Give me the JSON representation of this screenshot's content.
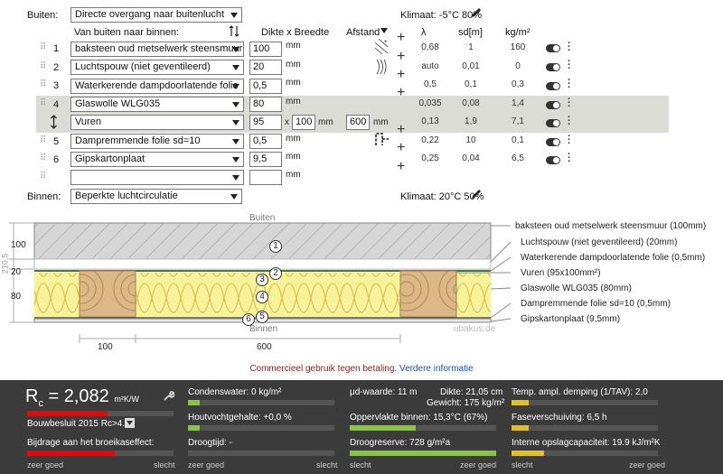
{
  "header": {
    "outside_label": "Buiten:",
    "outside_value": "Directe overgang naar buitenlucht",
    "climate_out": "Klimaat: -5°C 80%",
    "inside_label": "Binnen:",
    "inside_value": "Beperkte luchtcirculatie",
    "climate_in": "Klimaat: 20°C 50%"
  },
  "columns": {
    "layers": "Van buiten naar binnen:",
    "thickness": "Dikte x Breedte",
    "spacing": "Afstand",
    "lambda": "λ",
    "sd": "sd[m]",
    "density": "kg/m²"
  },
  "layers": [
    {
      "num": "1",
      "name": "baksteen oud metselwerk steensmuur",
      "thick": "100",
      "unit": "mm",
      "lambda": "0,68",
      "sd": "1",
      "kg": "160"
    },
    {
      "num": "2",
      "name": "Luchtspouw (niet geventileerd)",
      "thick": "20",
      "unit": "mm",
      "lambda": "auto",
      "sd": "0,01",
      "kg": "0"
    },
    {
      "num": "3",
      "name": "Waterkerende dampdoorlatende folie",
      "thick": "0,5",
      "unit": "mm",
      "lambda": "0,5",
      "sd": "0,1",
      "kg": "0,3"
    },
    {
      "num": "4",
      "name": "Glaswolle WLG035",
      "thick": "80",
      "unit": "mm",
      "lambda": "0,035",
      "sd": "0,08",
      "kg": "1,4"
    },
    {
      "num": "",
      "name": "Vuren",
      "thick": "95",
      "unit": "mm",
      "width": "100",
      "spacing": "600",
      "lambda": "0,13",
      "sd": "1,9",
      "kg": "7,1"
    },
    {
      "num": "5",
      "name": "Dampremmende folie sd=10",
      "thick": "0,5",
      "unit": "mm",
      "lambda": "0,22",
      "sd": "10",
      "kg": "0,1"
    },
    {
      "num": "6",
      "name": "Gipskartonplaat",
      "thick": "9,5",
      "unit": "mm",
      "lambda": "0,25",
      "sd": "0,04",
      "kg": "6,5"
    },
    {
      "num": "",
      "name": "",
      "thick": "",
      "unit": "mm"
    }
  ],
  "diagram": {
    "outside": "Buiten",
    "inside": "Binnen",
    "watermark": "ubakus.de",
    "left_dims": [
      "100",
      "20",
      "80"
    ],
    "total_dim": "210,5",
    "bottom_dims": [
      "100",
      "600"
    ],
    "legend": [
      "baksteen oud metselwerk steensmuur (100mm)",
      "Luchtspouw (niet geventileerd) (20mm)",
      "Waterkerende dampdoorlatende folie (0,5mm)",
      "Vuren (95x100mm²)",
      "Glaswolle WLG035 (80mm)",
      "Dampremmende folie sd=10 (0,5mm)",
      "Gipskartonplaat (9,5mm)"
    ],
    "markers": [
      "1",
      "2",
      "3",
      "4",
      "5",
      "6"
    ]
  },
  "notice": {
    "text": "Commercieel gebruik tegen betaling.",
    "link": "Verdere informatie"
  },
  "results": {
    "rc_label": "R",
    "rc_sub": "c",
    "rc_value": "= 2,082",
    "rc_unit": "m²K/W",
    "rc_fill": 0.55,
    "norm": "Bouwbesluit 2015 Rc>4.5",
    "greenhouse": "Bijdrage aan het broeikaseffect:",
    "good": "zeer goed",
    "bad": "slecht",
    "condensate": "Condenswater: 0 kg/m²",
    "moisture": "Houtvochtgehalte: +0,0 %",
    "drying": "Droogtijd: -",
    "ud": "μd-waarde: 11 m",
    "thickness": "Dikte: 21,05 cm",
    "weight": "Gewicht: 175 kg/m²",
    "surface": "Oppervlakte binnen: 15,3°C (67%)",
    "reserve": "Droogreserve: 728 g/m²a",
    "damping": "Temp. ampl. demping (1/TAV): 2,0",
    "phase": "Faseverschuiving: 6,5 h",
    "capacity": "Interne opslagcapaciteit: 19.9 kJ/m²K"
  },
  "colors": {
    "highlight": "#dcdcd6",
    "panel": "#3b3b3b",
    "red": "#d21010",
    "green": "#8bc34a",
    "yellow": "#e0c028",
    "link": "#1a4fb5",
    "notice": "#8a1b1b"
  }
}
